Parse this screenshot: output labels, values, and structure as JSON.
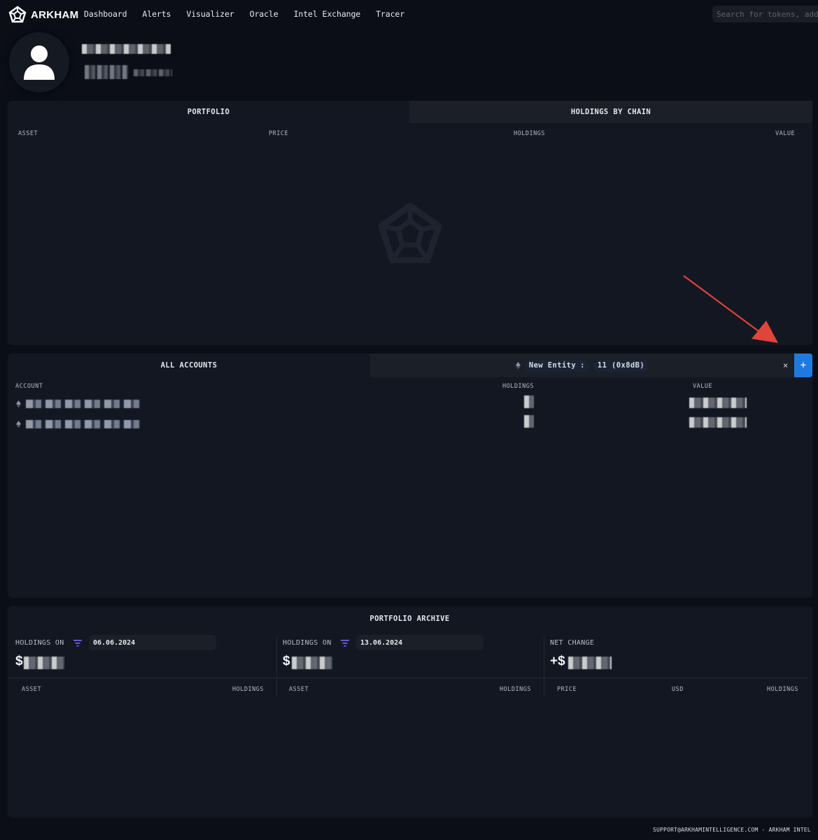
{
  "brand": {
    "name": "ARKHAM"
  },
  "nav": {
    "items": [
      "Dashboard",
      "Alerts",
      "Visualizer",
      "Oracle",
      "Intel Exchange",
      "Tracer"
    ],
    "search_placeholder": "Search for tokens, add"
  },
  "portfolio": {
    "tabs": [
      "PORTFOLIO",
      "HOLDINGS BY CHAIN"
    ],
    "columns": [
      "ASSET",
      "PRICE",
      "HOLDINGS",
      "VALUE"
    ]
  },
  "accounts": {
    "tab_all": "ALL ACCOUNTS",
    "entity_name": "New Entity",
    "entity_sep": ":",
    "entity_address": "11 (0x8dB)",
    "close_symbol": "×",
    "add_symbol": "+",
    "columns": [
      "ACCOUNT",
      "HOLDINGS",
      "VALUE"
    ]
  },
  "archive": {
    "title": "PORTFOLIO ARCHIVE",
    "left": {
      "label": "HOLDINGS ON",
      "date": "06.06.2024",
      "currency": "$",
      "columns": [
        "ASSET",
        "HOLDINGS"
      ]
    },
    "middle": {
      "label": "HOLDINGS ON",
      "date": "13.06.2024",
      "currency": "$",
      "columns": [
        "ASSET",
        "HOLDINGS"
      ]
    },
    "right": {
      "label": "NET CHANGE",
      "currency": "+$",
      "columns": [
        "PRICE",
        "USD",
        "HOLDINGS"
      ]
    }
  },
  "footer": {
    "text": "SUPPORT@ARKHAMINTELLIGENCE.COM - ARKHAM INTEL"
  },
  "colors": {
    "accent": "#1f7ae0",
    "filter": "#7b6cf6",
    "arrow": "#e0443a"
  }
}
